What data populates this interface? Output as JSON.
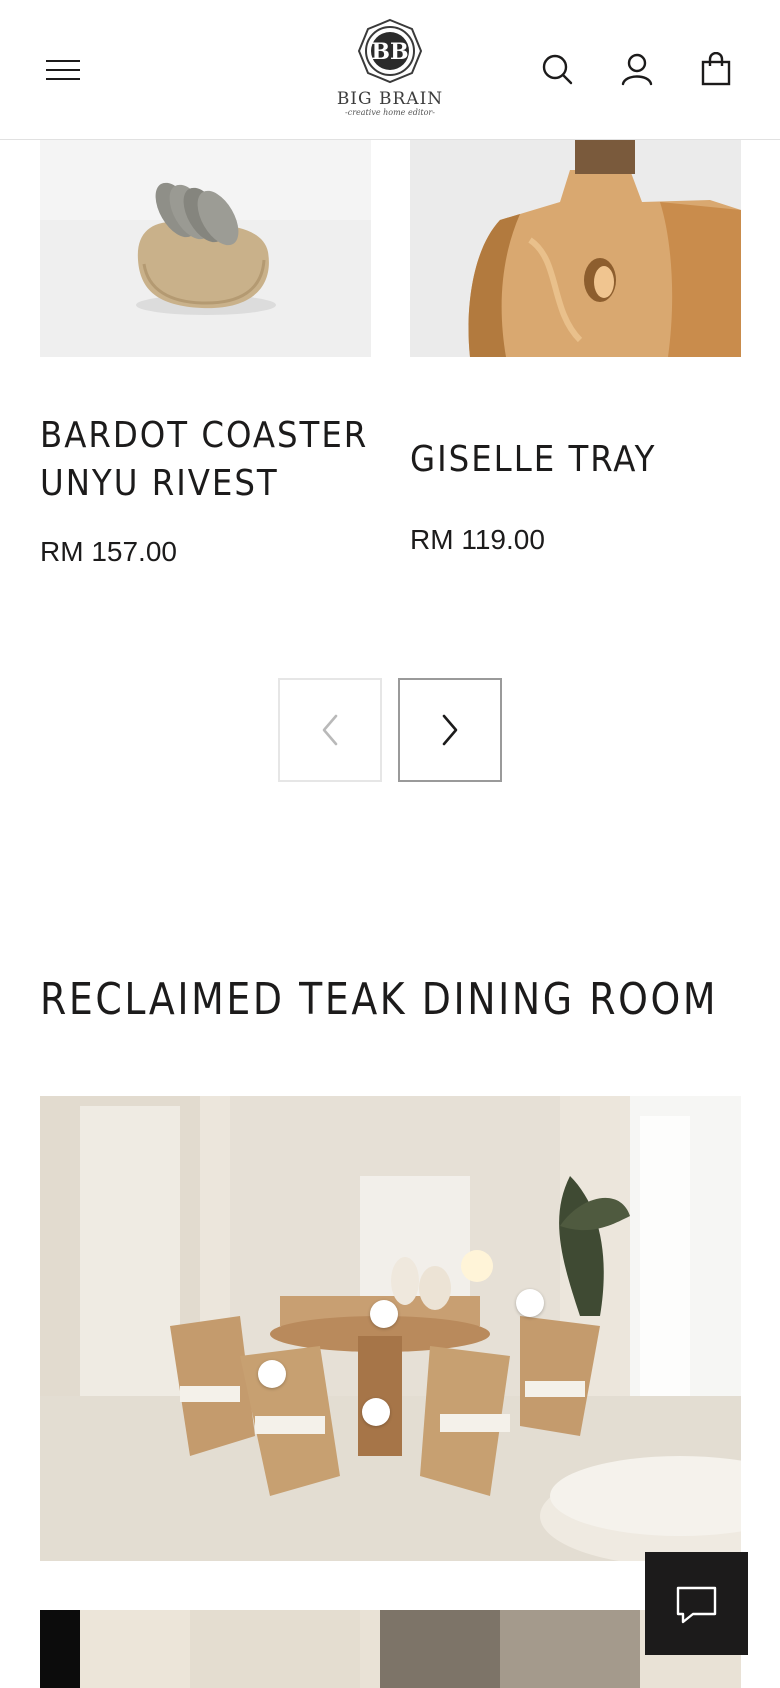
{
  "brand": {
    "name": "BIG BRAIN",
    "tagline": "-creative home editor-",
    "monogram": "BB"
  },
  "header": {
    "menu_icon": "hamburger-icon",
    "search_icon": "search-icon",
    "account_icon": "user-icon",
    "cart_icon": "shopping-bag-icon"
  },
  "products": [
    {
      "title_line1": "BARDOT COASTER",
      "title_line2": "UNYU RIVEST",
      "price": "RM 157.00"
    },
    {
      "title_line1": "GISELLE TRAY",
      "title_line2": "",
      "price": "RM 119.00"
    }
  ],
  "pager": {
    "prev_icon": "chevron-left-icon",
    "next_icon": "chevron-right-icon"
  },
  "section": {
    "title": "RECLAIMED TEAK DINING ROOM"
  },
  "chat": {
    "icon": "chat-bubble-icon"
  }
}
